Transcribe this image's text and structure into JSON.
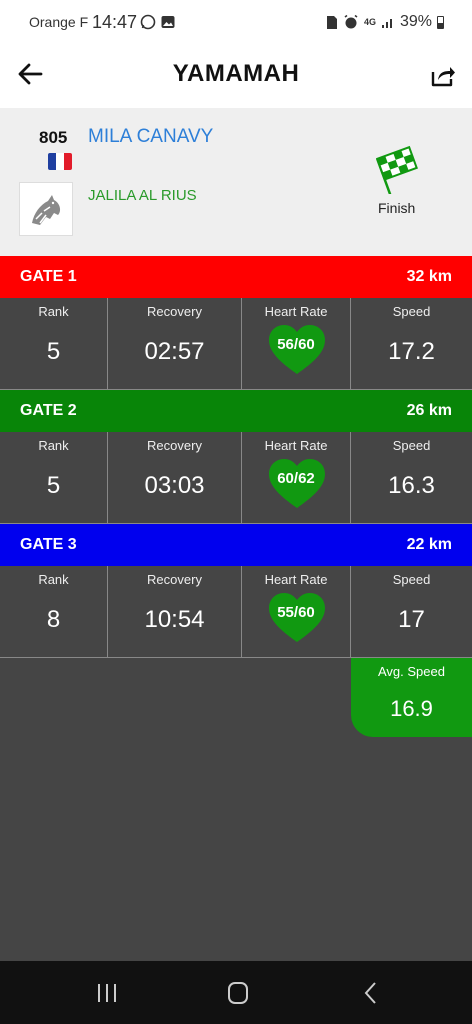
{
  "status": {
    "carrier": "Orange F",
    "time": "14:47",
    "battery": "39%",
    "network": "4G"
  },
  "app": {
    "title": "YAMAMAH"
  },
  "rider": {
    "number": "805",
    "name": "MILA CANAVY",
    "horse": "JALILA AL RIUS",
    "flag_colors": [
      "#1f3fa0",
      "#ffffff",
      "#e21c2a"
    ],
    "status": "Finish"
  },
  "labels": {
    "rank": "Rank",
    "recovery": "Recovery",
    "heart_rate": "Heart Rate",
    "speed": "Speed"
  },
  "gates": [
    {
      "name": "GATE 1",
      "distance": "32 km",
      "color": "#ff0000",
      "rank": "5",
      "recovery": "02:57",
      "heart_rate": "56/60",
      "speed": "17.2"
    },
    {
      "name": "GATE 2",
      "distance": "26 km",
      "color": "#088508",
      "rank": "5",
      "recovery": "03:03",
      "heart_rate": "60/62",
      "speed": "16.3"
    },
    {
      "name": "GATE 3",
      "distance": "22 km",
      "color": "#0000ee",
      "rank": "8",
      "recovery": "10:54",
      "heart_rate": "55/60",
      "speed": "17"
    }
  ],
  "average": {
    "label": "Avg. Speed",
    "value": "16.9"
  },
  "colors": {
    "heart": "#119911",
    "accent_blue": "#2d7fd8",
    "accent_green": "#2a9a2a"
  }
}
